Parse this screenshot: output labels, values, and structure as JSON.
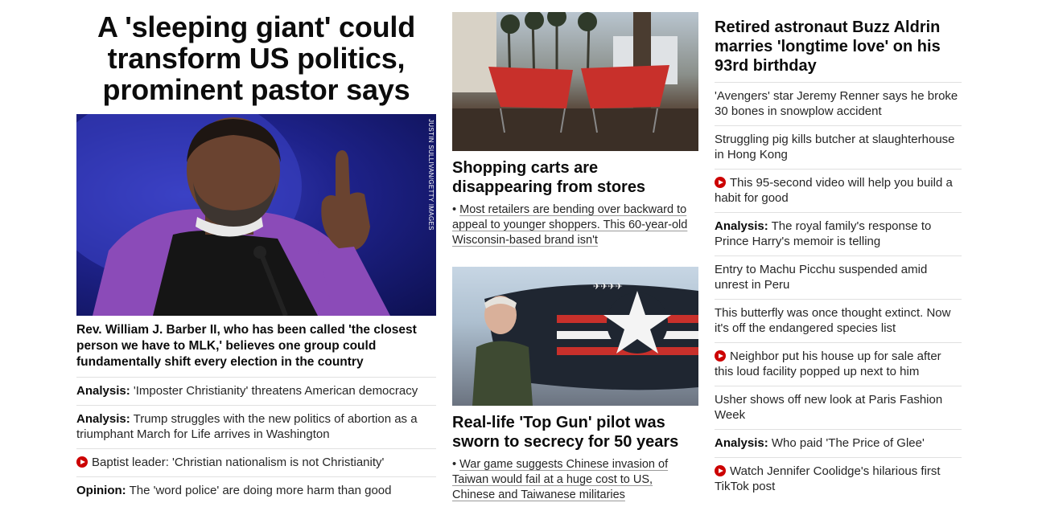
{
  "left": {
    "headline": "A 'sleeping giant' could transform US politics, prominent pastor says",
    "image_credit": "JUSTIN SULLIVAN/GETTY IMAGES",
    "caption": "Rev. William J. Barber II, who has been called 'the closest person we have to MLK,' believes one group could fundamentally shift every election in the country",
    "links": [
      {
        "prefix": "Analysis:",
        "text": "'Imposter Christianity' threatens American democracy"
      },
      {
        "prefix": "Analysis:",
        "text": "Trump struggles with the new politics of abortion as a triumphant March for Life arrives in Washington"
      },
      {
        "video": true,
        "text": "Baptist leader: 'Christian nationalism is not Christianity'"
      },
      {
        "prefix": "Opinion:",
        "text": "The 'word police' are doing more harm than good"
      }
    ]
  },
  "middle": {
    "cards": [
      {
        "title": "Shopping carts are disappearing from stores",
        "bullet": "Most retailers are bending over backward to appeal to younger shoppers. This 60-year-old Wisconsin-based brand isn't"
      },
      {
        "title": "Real-life 'Top Gun' pilot was sworn to secrecy for 50 years",
        "bullet": "War game suggests Chinese invasion of Taiwan would fail at a huge cost to US, Chinese and Taiwanese militaries"
      }
    ]
  },
  "right": {
    "headline": "Retired astronaut Buzz Aldrin marries 'longtime love' on his 93rd birthday",
    "links": [
      {
        "text": "'Avengers' star Jeremy Renner says he broke 30 bones in snowplow accident"
      },
      {
        "text": "Struggling pig kills butcher at slaughterhouse in Hong Kong"
      },
      {
        "video": true,
        "text": "This 95-second video will help you build a habit for good"
      },
      {
        "prefix": "Analysis:",
        "text": "The royal family's response to Prince Harry's memoir is telling"
      },
      {
        "text": "Entry to Machu Picchu suspended amid unrest in Peru"
      },
      {
        "text": "This butterfly was once thought extinct. Now it's off the endangered species list"
      },
      {
        "video": true,
        "text": "Neighbor put his house up for sale after this loud facility popped up next to him"
      },
      {
        "text": "Usher shows off new look at Paris Fashion Week"
      },
      {
        "prefix": "Analysis:",
        "text": "Who paid 'The Price of Glee'"
      },
      {
        "video": true,
        "text": "Watch Jennifer Coolidge's hilarious first TikTok post"
      }
    ]
  },
  "colors": {
    "text": "#0c0c0c",
    "video_icon": "#cc0000",
    "divider": "#e0e0e0"
  }
}
